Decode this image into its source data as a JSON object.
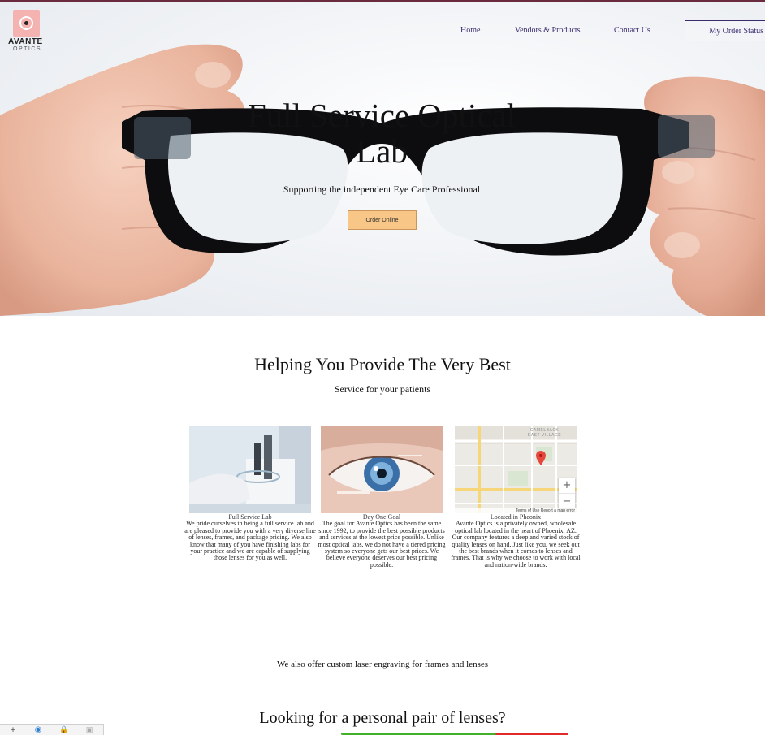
{
  "brand": {
    "logo_word": "AVANTE",
    "logo_sub": "OPTICS",
    "accent": "#f4b3b1"
  },
  "nav": {
    "home": "Home",
    "vendors": "Vendors & Products",
    "contact": "Contact Us",
    "order_status": "My Order Status"
  },
  "hero": {
    "title": "Full Service Optical Lab",
    "subtitle": "Supporting the independent Eye Care Professional",
    "cta": "Order Online",
    "cta_color": "#f8c686"
  },
  "section": {
    "heading": "Helping You Provide The Very Best",
    "subheading": "Service for your patients"
  },
  "cards": [
    {
      "title": "Full Service Lab",
      "text": "We pride ourselves in being a full service lab and are pleased to provide you with a very diverse line of lenses, frames, and package pricing. We also know that many of you have finishing labs for your practice and we are capable of supplying those lenses for you as well."
    },
    {
      "title": "Day One Goal",
      "text": "The goal for Avante Optics has been the same since 1992, to provide the best possible products and services at the lowest price possible. Unlike most optical labs, we do not have a tiered pricing system so everyone gets our best prices. We believe everyone deserves our best pricing possible."
    },
    {
      "title": "Located in Pheonix",
      "text": "Avante Optics is a privately owned, wholesale optical lab located in the heart of Phoenix, AZ. Our company features a deep and varied stock of quality lenses on hand. Just like you, we seek out the best brands when it comes to lenses and frames. That is why we choose to work with local and nation-wide brands."
    }
  ],
  "map": {
    "area_label_1": "CAMELBACK",
    "area_label_2": "EAST VILLAGE",
    "zoom_in": "+",
    "zoom_out": "−",
    "terms": "Terms of Use",
    "report": "Report a map error"
  },
  "engraving": "We also offer custom laser engraving for frames and lenses",
  "personal_heading": "Looking for a personal pair of lenses?",
  "toolbar": {
    "add": "+"
  }
}
